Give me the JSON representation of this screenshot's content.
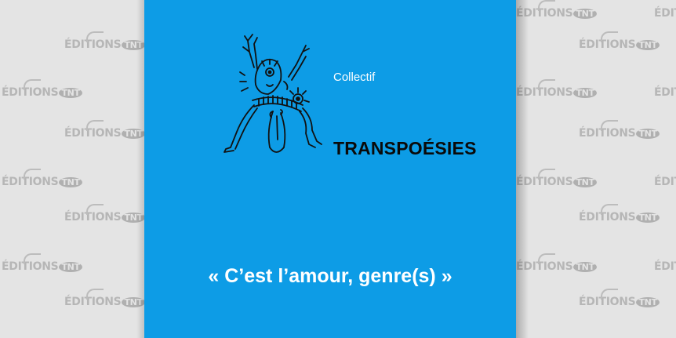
{
  "watermark": {
    "brand_text": "ÉDITIONS",
    "brand_badge": "TNT",
    "brand_text_cut": "ÉDITIONS"
  },
  "cover": {
    "author": "Collectif",
    "title": "TRANSPOÉSIES",
    "subtitle": "« C’est l’amour, genre(s) »",
    "background_color": "#0d9ce6",
    "illustration": "line-drawing-dancing-figure"
  }
}
